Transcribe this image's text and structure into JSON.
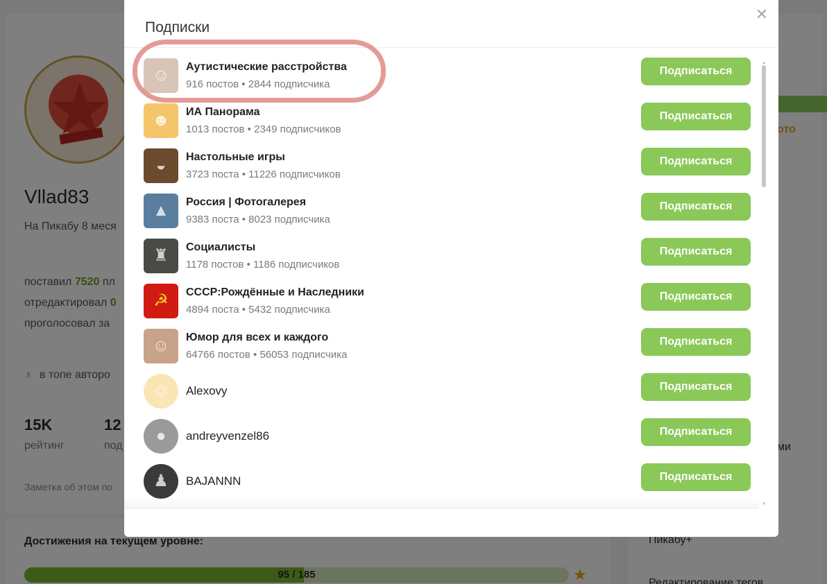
{
  "background": {
    "username": "Vllad83",
    "since": "На Пикабу 8 меся",
    "stats": [
      {
        "prefix": "поставил ",
        "value": "7520",
        "suffix": " пл"
      },
      {
        "prefix": "отредактировал ",
        "value": "0",
        "suffix": ""
      },
      {
        "prefix": "проголосовал за",
        "value": "",
        "suffix": ""
      }
    ],
    "top_authors": "в топе авторо",
    "rating_value": "15K",
    "rating_label": "рейтинг",
    "subscribers_value": "12",
    "subscribers_label": "под",
    "note": "Заметка об этом по",
    "achievements_title": "Достижения на текущем уровне:",
    "progress_text": "95 / 185",
    "progress_fraction": 0.5135,
    "right_orange": "ото",
    "right_texts": [
      "ми",
      "Пикабу+",
      "Редактирование тегов"
    ]
  },
  "modal": {
    "title": "Подписки",
    "close_icon": "close-icon",
    "subscribe_label": "Подписаться",
    "items": [
      {
        "name": "Аутистические расстройства",
        "meta": "916 постов • 2844 подписчика",
        "avatar": "baby-photo",
        "avatar_color": "#d9c4b8"
      },
      {
        "name": "ИА Панорама",
        "meta": "1013 постов • 2349 подписчиков",
        "avatar": "cartoon-faces",
        "avatar_color": "#f4c56a"
      },
      {
        "name": "Настольные игры",
        "meta": "3723 поста • 11226 подписчиков",
        "avatar": "food-photo",
        "avatar_color": "#6b4a2e"
      },
      {
        "name": "Россия | Фотогалерея",
        "meta": "9383 поста • 8023 подписчика",
        "avatar": "landscape-photo",
        "avatar_color": "#5a7ea0"
      },
      {
        "name": "Социалисты",
        "meta": "1178 постов • 1186 подписчиков",
        "avatar": "statue-photo",
        "avatar_color": "#4a4a44"
      },
      {
        "name": "СССР:Рождённые и Наследники",
        "meta": "4894 поста • 5432 подписчика",
        "avatar": "hammer-sickle",
        "avatar_color": "#d11a12"
      },
      {
        "name": "Юмор для всех и каждого",
        "meta": "64766 постов • 56053 подписчика",
        "avatar": "man-photo",
        "avatar_color": "#c9a28a"
      },
      {
        "name": "Alexovy",
        "meta": "",
        "avatar": "chef-cartoon",
        "avatar_color": "#fae6b4"
      },
      {
        "name": "andreyvenzel86",
        "meta": "",
        "avatar": "person-photo",
        "avatar_color": "#9a9a9a"
      },
      {
        "name": "BAJANNN",
        "meta": "",
        "avatar": "person-photo-bw",
        "avatar_color": "#3a3a3a"
      }
    ]
  },
  "colors": {
    "subscribe_button": "#8ac858",
    "highlight": "#e0908c",
    "positive": "#6a9c1f"
  }
}
